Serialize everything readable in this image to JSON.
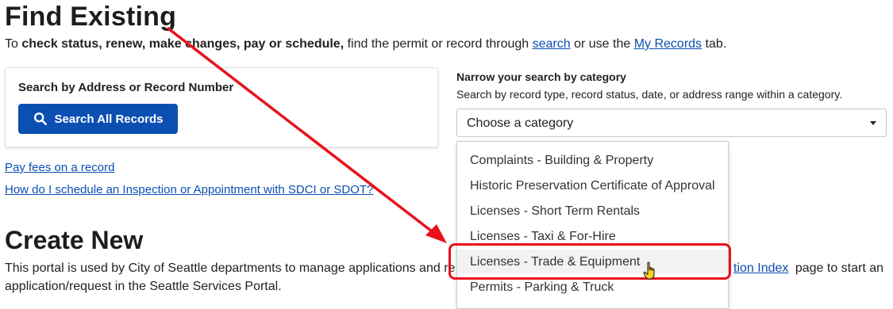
{
  "find_existing": {
    "title": "Find Existing",
    "intro_prefix": "To ",
    "intro_bold": "check status, renew, make changes, pay or schedule,",
    "intro_mid": " find the permit or record through ",
    "search_link": "search",
    "intro_or": " or use the ",
    "my_records_link": "My Records",
    "intro_suffix": " tab."
  },
  "search_card": {
    "title": "Search by Address or Record Number",
    "button_label": "Search All Records"
  },
  "links": {
    "pay_fees": "Pay fees on a record",
    "schedule_inspection": "How do I schedule an Inspection or Appointment with SDCI or SDOT?"
  },
  "narrow": {
    "title": "Narrow your search by category",
    "description": "Search by record type, record status, date, or address range within a category.",
    "select_value": "Choose a category"
  },
  "dropdown_items": [
    "Complaints - Building & Property",
    "Historic Preservation Certificate of Approval",
    "Licenses - Short Term Rentals",
    "Licenses - Taxi & For-Hire",
    "Licenses - Trade & Equipment",
    "Permits - Parking & Truck"
  ],
  "create_new": {
    "title": "Create New",
    "text_start": "This portal is used by City of Seattle departments to manage applications and re",
    "link_partial": "tion Index",
    "text_after_link": " page to start an",
    "text_line2": "application/request in the Seattle Services Portal."
  },
  "colors": {
    "primary": "#0b4fb3",
    "annotation_red": "#e8121b"
  }
}
